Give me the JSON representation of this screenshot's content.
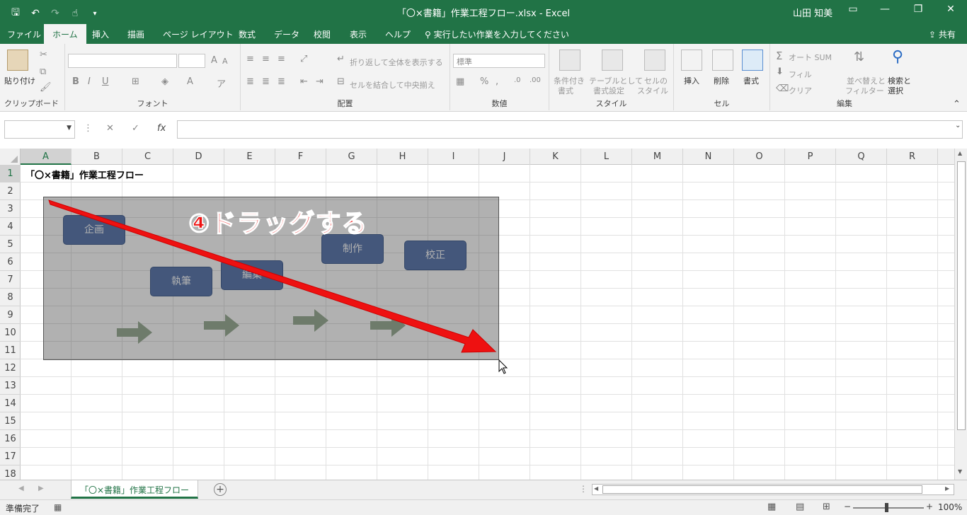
{
  "window": {
    "title": "「〇×書籍」作業工程フロー.xlsx  -  Excel",
    "user": "山田 知美"
  },
  "tabs": [
    "ファイル",
    "ホーム",
    "挿入",
    "描画",
    "ページ レイアウト",
    "数式",
    "データ",
    "校閲",
    "表示",
    "ヘルプ"
  ],
  "tell_me": "実行したい作業を入力してください",
  "share": "共有",
  "ribbon": {
    "clipboard": {
      "label": "クリップボード",
      "paste": "貼り付け"
    },
    "font": {
      "label": "フォント"
    },
    "alignment": {
      "label": "配置",
      "wrap": "折り返して全体を表示する",
      "merge": "セルを結合して中央揃え"
    },
    "number": {
      "label": "数値",
      "format": "標準"
    },
    "styles": {
      "label": "スタイル",
      "conditional": "条件付き",
      "conditional2": "書式",
      "table": "テーブルとして",
      "table2": "書式設定",
      "cell": "セルの",
      "cell2": "スタイル"
    },
    "cells": {
      "label": "セル",
      "insert": "挿入",
      "delete": "削除",
      "format": "書式"
    },
    "editing": {
      "label": "編集",
      "autosum": "オート SUM",
      "fill": "フィル",
      "clear": "クリア",
      "sort": "並べ替えと",
      "sort2": "フィルター",
      "find": "検索と",
      "find2": "選択"
    }
  },
  "formula_bar": {
    "fx": "fx",
    "value": ""
  },
  "columns": [
    "A",
    "B",
    "C",
    "D",
    "E",
    "F",
    "G",
    "H",
    "I",
    "J",
    "K",
    "L",
    "M",
    "N",
    "O",
    "P",
    "Q",
    "R"
  ],
  "rows": [
    "1",
    "2",
    "3",
    "4",
    "5",
    "6",
    "7",
    "8",
    "9",
    "10",
    "11",
    "12",
    "13",
    "14",
    "15",
    "16",
    "17",
    "18"
  ],
  "cell_a1": "「〇×書籍」作業工程フロー",
  "shapes": [
    "企画",
    "執筆",
    "編集",
    "制作",
    "校正"
  ],
  "callout": "④ドラッグする",
  "sheet_tab": "「〇×書籍」作業工程フロー",
  "status": {
    "ready": "準備完了",
    "zoom": "100%"
  },
  "colors": {
    "accent": "#217346",
    "shape_fill": "#4a6aa5",
    "callout": "#ee1111",
    "flow_arrow": "#8fa58a"
  }
}
